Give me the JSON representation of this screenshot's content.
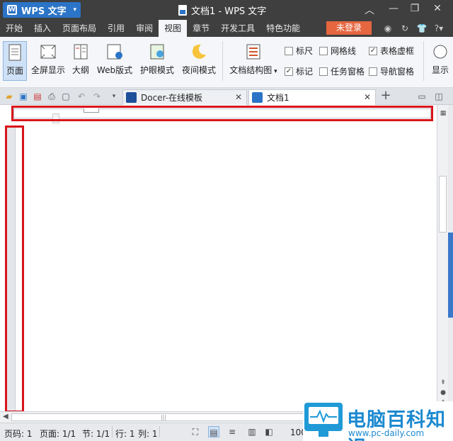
{
  "titlebar": {
    "app_label": "WPS 文字",
    "doc_title": "文档1 - WPS 文字"
  },
  "menu": {
    "items": [
      "开始",
      "插入",
      "页面布局",
      "引用",
      "审阅",
      "视图",
      "章节",
      "开发工具",
      "特色功能"
    ],
    "active": "视图",
    "login": "未登录"
  },
  "ribbon": {
    "buttons": [
      "页面",
      "全屏显示",
      "大纲",
      "Web版式",
      "护眼模式",
      "夜间模式",
      "文档结构图",
      "显示"
    ],
    "checkboxes": {
      "ruler": "标尺",
      "gridlines": "网格线",
      "table_gridlines": "表格虚框",
      "marks": "标记",
      "task_pane": "任务窗格",
      "nav_pane": "导航窗格"
    }
  },
  "tabs": {
    "docer": "Docer-在线模板",
    "doc1": "文档1",
    "add": "+"
  },
  "status": {
    "page_num": "页码: 1",
    "page": "页面: 1/1",
    "section": "节: 1/1",
    "line": "行: 1",
    "col": "列: 1",
    "zoom": "100"
  },
  "watermark": {
    "name": "电脑百科知识",
    "url": "www.pc-daily.com"
  },
  "colors": {
    "accent": "#2b74c7",
    "login": "#e5663f",
    "highlight": "#d9141b"
  }
}
